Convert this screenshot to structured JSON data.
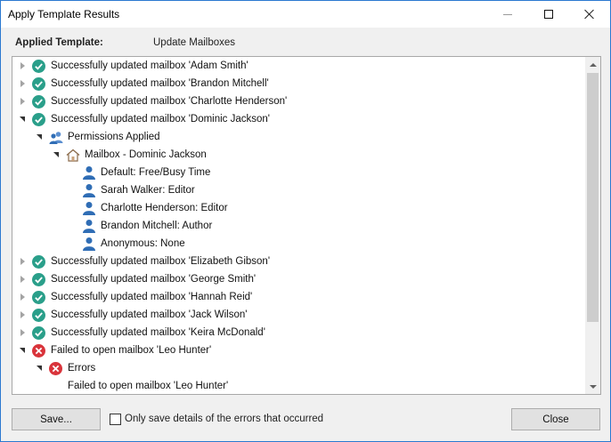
{
  "window": {
    "title": "Apply Template Results"
  },
  "applied_template": {
    "label": "Applied Template:",
    "value": "Update Mailboxes"
  },
  "tree": {
    "rows": [
      {
        "text": "Successfully updated mailbox 'Adam Smith'",
        "icon": "check-circle-icon",
        "state": "collapsed"
      },
      {
        "text": "Successfully updated mailbox 'Brandon Mitchell'",
        "icon": "check-circle-icon",
        "state": "collapsed"
      },
      {
        "text": "Successfully updated mailbox 'Charlotte Henderson'",
        "icon": "check-circle-icon",
        "state": "collapsed"
      },
      {
        "text": "Successfully updated mailbox 'Dominic Jackson'",
        "icon": "check-circle-icon",
        "state": "expanded"
      },
      {
        "text": "Permissions Applied",
        "icon": "users-icon",
        "state": "expanded"
      },
      {
        "text": "Mailbox - Dominic Jackson",
        "icon": "home-icon",
        "state": "expanded"
      },
      {
        "text": "Default: Free/Busy Time",
        "icon": "user-icon",
        "state": "leaf"
      },
      {
        "text": "Sarah Walker: Editor",
        "icon": "user-icon",
        "state": "leaf"
      },
      {
        "text": "Charlotte Henderson: Editor",
        "icon": "user-icon",
        "state": "leaf"
      },
      {
        "text": "Brandon Mitchell: Author",
        "icon": "user-icon",
        "state": "leaf"
      },
      {
        "text": "Anonymous: None",
        "icon": "user-icon",
        "state": "leaf"
      },
      {
        "text": "Successfully updated mailbox 'Elizabeth Gibson'",
        "icon": "check-circle-icon",
        "state": "collapsed"
      },
      {
        "text": "Successfully updated mailbox 'George Smith'",
        "icon": "check-circle-icon",
        "state": "collapsed"
      },
      {
        "text": "Successfully updated mailbox 'Hannah Reid'",
        "icon": "check-circle-icon",
        "state": "collapsed"
      },
      {
        "text": "Successfully updated mailbox 'Jack Wilson'",
        "icon": "check-circle-icon",
        "state": "collapsed"
      },
      {
        "text": "Successfully updated mailbox 'Keira McDonald'",
        "icon": "check-circle-icon",
        "state": "collapsed"
      },
      {
        "text": "Failed to open mailbox 'Leo Hunter'",
        "icon": "error-circle-icon",
        "state": "expanded"
      },
      {
        "text": "Errors",
        "icon": "error-circle-icon",
        "state": "expanded"
      },
      {
        "text": "Failed to open mailbox 'Leo Hunter'",
        "icon": "",
        "state": "leaf"
      }
    ]
  },
  "footer": {
    "save_label": "Save...",
    "checkbox_label": "Only save details of the errors that occurred",
    "checkbox_checked": false,
    "close_label": "Close"
  },
  "colors": {
    "success": "#2a9f8a",
    "error": "#d9343b",
    "user": "#2f6db5",
    "window_border": "#2b79d0"
  }
}
